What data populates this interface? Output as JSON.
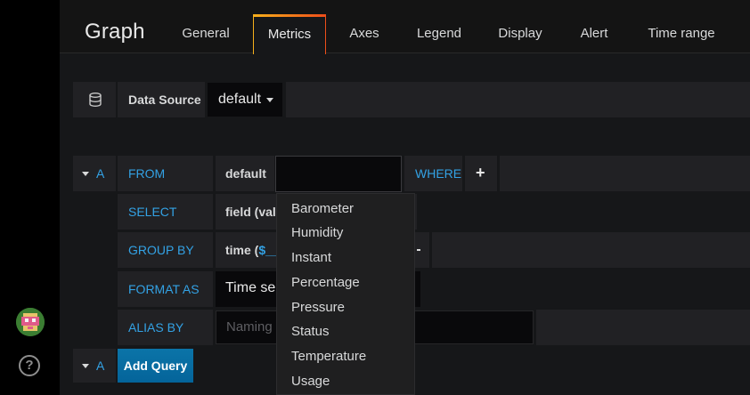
{
  "app": {
    "title": "Graph"
  },
  "tabs": [
    {
      "label": "General"
    },
    {
      "label": "Metrics"
    },
    {
      "label": "Axes"
    },
    {
      "label": "Legend"
    },
    {
      "label": "Display"
    },
    {
      "label": "Alert"
    },
    {
      "label": "Time range"
    }
  ],
  "active_tab": "Metrics",
  "datasource": {
    "label": "Data Source",
    "value": "default",
    "icon": "database-icon"
  },
  "query": {
    "ref_id": "A",
    "from": {
      "label": "FROM",
      "policy": "default",
      "measurement": "",
      "where_label": "WHERE",
      "add_label": "+"
    },
    "select": {
      "label": "SELECT",
      "value": "field (valu"
    },
    "group_by": {
      "label": "GROUP BY",
      "prefix": "time (",
      "var": "$__"
    },
    "format_as": {
      "label": "FORMAT AS",
      "value": "Time se"
    },
    "alias_by": {
      "label": "ALIAS BY",
      "placeholder": "Naming"
    }
  },
  "measurement_options": [
    "Barometer",
    "Humidity",
    "Instant",
    "Percentage",
    "Pressure",
    "Status",
    "Temperature",
    "Usage"
  ],
  "add_query": {
    "ref_id": "A",
    "label": "Add Query"
  },
  "colors": {
    "keyword": "#33a2e5",
    "button": "#0b74a8",
    "tab_accent": "#f6b01b"
  },
  "sidebar": {
    "help_icon": "help-icon",
    "avatar": "user-avatar"
  }
}
